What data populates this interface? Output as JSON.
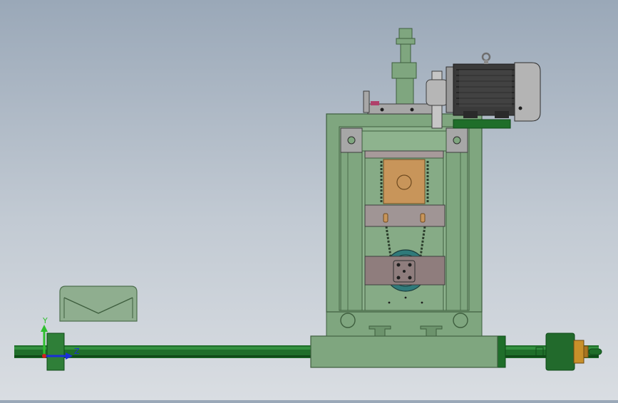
{
  "viewport": {
    "background_top": "#9aa8b8",
    "background_bottom": "#d9dde2"
  },
  "axes_triad": {
    "y_label": "Y",
    "z_label": "Z",
    "y_color": "#2fbf2f",
    "z_color": "#1a2fd8",
    "x_color": "#d21e1e"
  },
  "colors": {
    "frame_green": "#7fa67f",
    "frame_green_dark": "#5e865e",
    "shaft_green": "#1f6e2a",
    "motor_gray": "#8c8c8c",
    "block_tan": "#c8955a",
    "plate_gray": "#8f7d7d",
    "nut_brass": "#c8902a"
  },
  "components": [
    "motor-icon",
    "frame-icon",
    "lead-screw-icon",
    "chain-drive-icon",
    "jack-handle-icon",
    "envelope-cover-icon"
  ]
}
